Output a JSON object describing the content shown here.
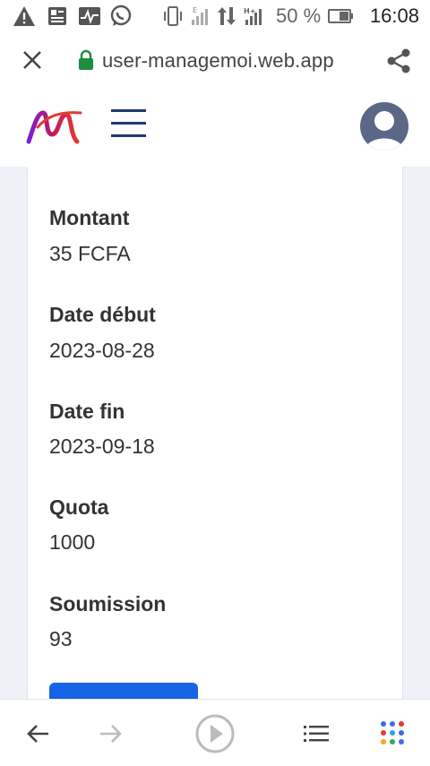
{
  "status_bar": {
    "battery_percent": "50 %",
    "time": "16:08",
    "icons": [
      "warning-icon",
      "news-icon",
      "activity-icon",
      "whatsapp-icon",
      "vibrate-icon",
      "signal-e-icon",
      "data-transfer-icon",
      "signal-h-icon",
      "battery-icon"
    ]
  },
  "browser": {
    "url": "user-managemoi.web.app",
    "icons": [
      "close-icon",
      "lock-icon",
      "share-icon"
    ]
  },
  "app_header": {
    "icons": [
      "brand-logo",
      "hamburger-menu-icon",
      "avatar-icon"
    ]
  },
  "details": {
    "fields": [
      {
        "label": "Montant",
        "value": "35 FCFA"
      },
      {
        "label": "Date début",
        "value": "2023-08-28"
      },
      {
        "label": "Date fin",
        "value": "2023-09-18"
      },
      {
        "label": "Quota",
        "value": "1000"
      },
      {
        "label": "Soumission",
        "value": "93"
      }
    ]
  },
  "colors": {
    "primary_button": "#1565e6",
    "page_background": "#eef1f8",
    "lock_green": "#1e8e3e"
  },
  "bottom_nav": {
    "icons": [
      "back-arrow-icon",
      "forward-arrow-icon",
      "play-icon",
      "list-icon",
      "apps-grid-icon"
    ]
  }
}
